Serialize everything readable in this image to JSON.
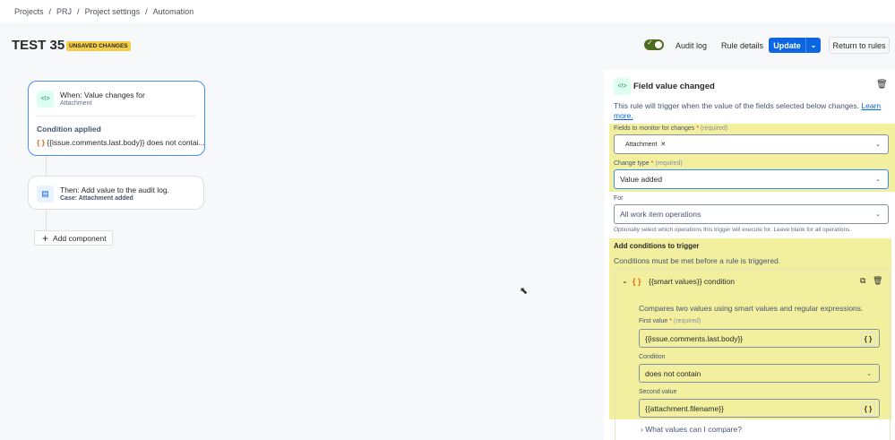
{
  "breadcrumb": [
    "Projects",
    "PRJ",
    "Project settings",
    "Automation"
  ],
  "rule": {
    "title": "TEST 35",
    "badge": "UNSAVED CHANGES"
  },
  "header": {
    "audit_log": "Audit log",
    "rule_details": "Rule details",
    "update": "Update",
    "return": "Return to rules",
    "toggle_on": true
  },
  "canvas": {
    "trigger": {
      "title": "When: Value changes for",
      "subtitle": "Attachment",
      "condition_label": "Condition applied",
      "condition_text": "{{issue.comments.last.body}} does not contai..."
    },
    "action": {
      "title": "Then: Add value to the audit log.",
      "subtitle": "Case: Attachment added"
    },
    "add_component": "Add component"
  },
  "panel": {
    "title": "Field value changed",
    "description": "This rule will trigger when the value of the fields selected below changes.",
    "learn_more": "Learn more.",
    "fields_label": "Fields to monitor for changes",
    "required": "(required)",
    "fields_value": "Attachment",
    "change_type_label": "Change type",
    "change_type_value": "Value added",
    "for_label": "For",
    "for_value": "All work item operations",
    "for_help": "Optionally select which operations this trigger will execute for. Leave blank for all operations.",
    "conditions_title": "Add conditions to trigger",
    "conditions_desc": "Conditions must be met before a rule is triggered.",
    "condition": {
      "title": "{{smart values}} condition",
      "desc": "Compares two values using smart values and regular expressions.",
      "first_label": "First value",
      "first_value": "{{issue.comments.last.body}}",
      "cond_label": "Condition",
      "cond_value": "does not contain",
      "second_label": "Second value",
      "second_value": "{{attachment.filename}}"
    },
    "what_values": "What values can I compare?"
  }
}
